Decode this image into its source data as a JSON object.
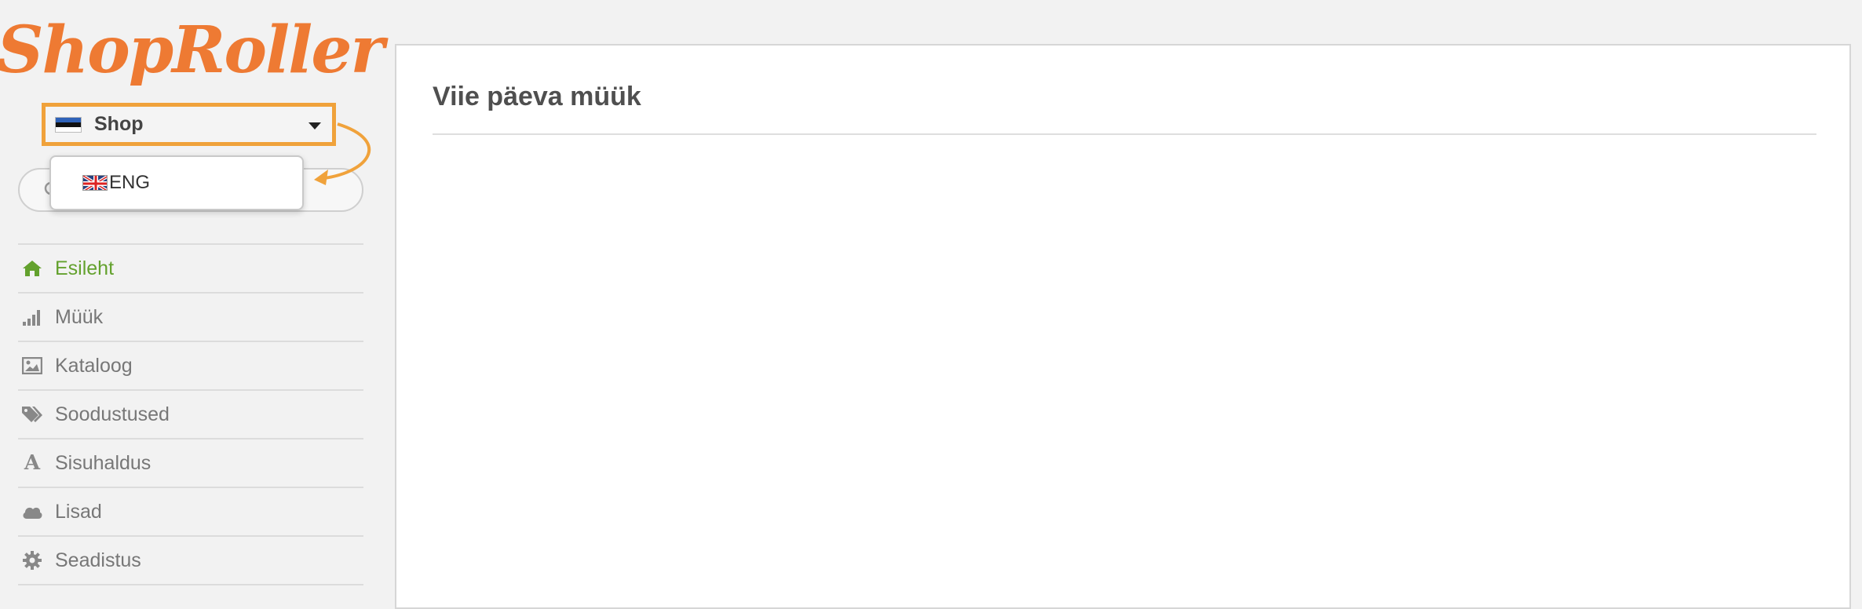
{
  "app": {
    "logo_text": "ShopRoller"
  },
  "shop_selector": {
    "label": "Shop",
    "flag": "estonia-flag"
  },
  "language_dropdown": {
    "option_label": "ENG",
    "flag": "uk-flag"
  },
  "search": {
    "placeholder": ""
  },
  "nav": {
    "items": [
      {
        "label": "Esileht",
        "icon": "home-icon",
        "active": true
      },
      {
        "label": "Müük",
        "icon": "bar-chart-icon",
        "active": false
      },
      {
        "label": "Kataloog",
        "icon": "image-icon",
        "active": false
      },
      {
        "label": "Soodustused",
        "icon": "tags-icon",
        "active": false
      },
      {
        "label": "Sisuhaldus",
        "icon": "font-icon",
        "active": false
      },
      {
        "label": "Lisad",
        "icon": "cloud-icon",
        "active": false
      },
      {
        "label": "Seadistus",
        "icon": "gear-icon",
        "active": false
      }
    ]
  },
  "main": {
    "title": "Viie päeva müük"
  },
  "colors": {
    "brand": "#ee7a33",
    "highlight": "#f0a23b",
    "active_nav": "#63a12d"
  }
}
